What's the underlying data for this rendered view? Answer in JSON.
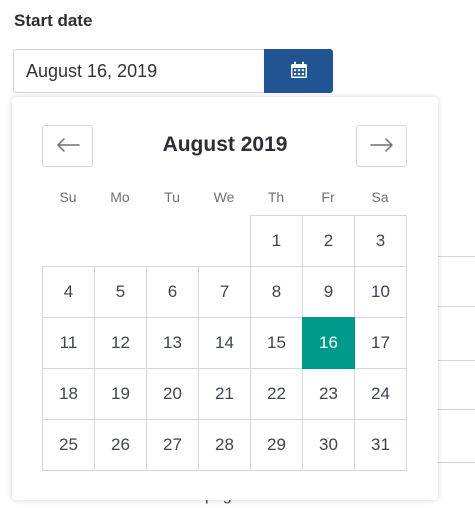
{
  "field": {
    "label": "Start date",
    "value": "August 16, 2019"
  },
  "calendar_button": {
    "icon": "calendar-icon",
    "color": "#205493"
  },
  "calendar": {
    "title": "August 2019",
    "prev_icon": "arrow-left-icon",
    "next_icon": "arrow-right-icon",
    "weekdays": [
      "Su",
      "Mo",
      "Tu",
      "We",
      "Th",
      "Fr",
      "Sa"
    ],
    "leading_blanks": 4,
    "days": [
      1,
      2,
      3,
      4,
      5,
      6,
      7,
      8,
      9,
      10,
      11,
      12,
      13,
      14,
      15,
      16,
      17,
      18,
      19,
      20,
      21,
      22,
      23,
      24,
      25,
      26,
      27,
      28,
      29,
      30,
      31
    ],
    "selected_day": 16,
    "selected_color": "#009a8c"
  },
  "background": {
    "partial_text": "pag"
  }
}
